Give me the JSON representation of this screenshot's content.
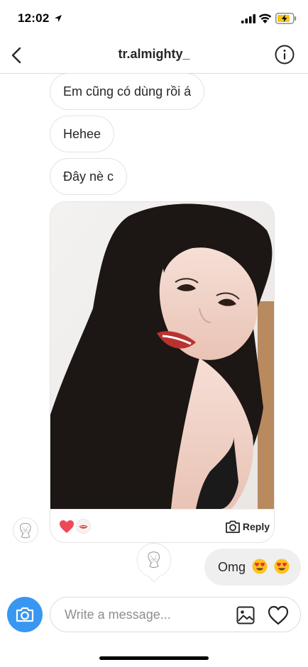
{
  "status_bar": {
    "time": "12:02",
    "icons": [
      "location-arrow-icon",
      "signal-icon",
      "wifi-icon",
      "battery-charging-icon"
    ]
  },
  "header": {
    "title": "tr.almighty_",
    "back_icon": "chevron-left-icon",
    "info_icon": "info-icon"
  },
  "messages": [
    {
      "text": "Em cũng có dùng rồi á"
    },
    {
      "text": "Hehee"
    },
    {
      "text": "Đây nè c"
    }
  ],
  "photo_message": {
    "reaction": "heart-icon",
    "reply_label": "Reply",
    "reply_icon": "camera-icon"
  },
  "outgoing": {
    "text": "Omg",
    "emoji": [
      "heart-eyes-emoji",
      "heart-eyes-emoji"
    ]
  },
  "composer": {
    "placeholder": "Write a message...",
    "value": "",
    "camera_icon": "camera-icon",
    "gallery_icon": "image-icon",
    "like_icon": "heart-outline-icon"
  },
  "colors": {
    "accent": "#3897f0",
    "reaction_heart": "#ed4956",
    "outgoing_bubble": "#efefef",
    "border": "#dbdbdb"
  }
}
